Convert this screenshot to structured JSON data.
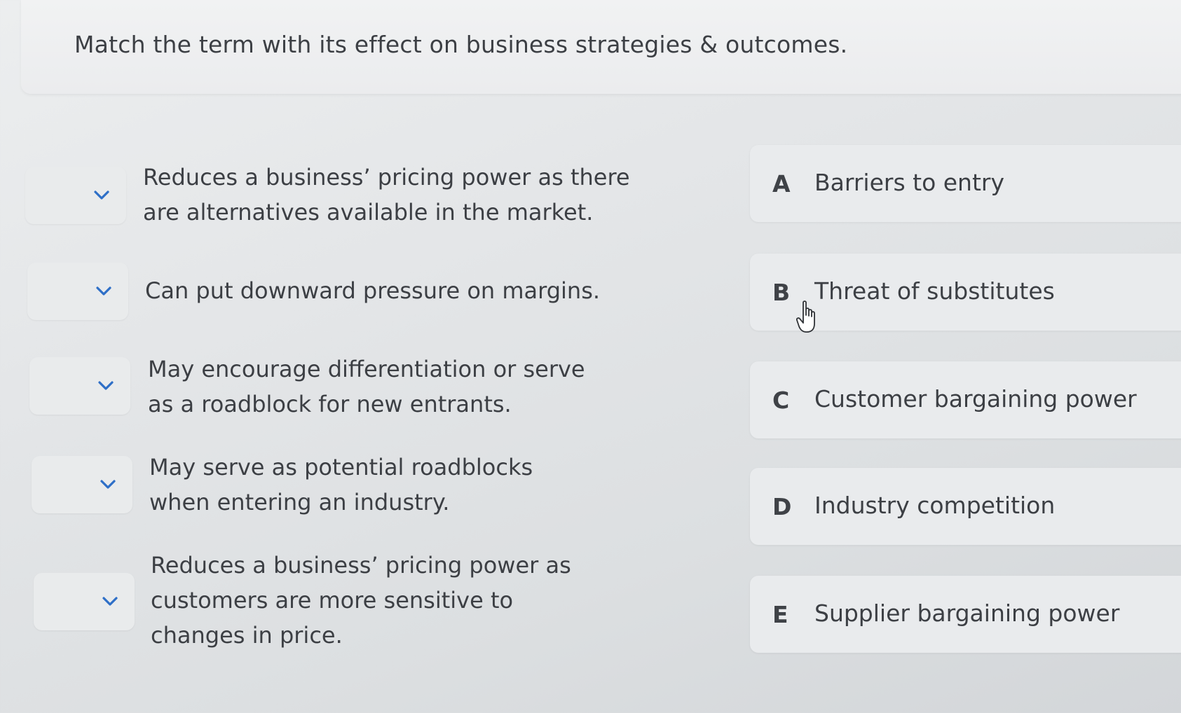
{
  "question": {
    "text": "Match the term with its effect on business strategies & outcomes."
  },
  "prompts": [
    {
      "text": "Reduces a business’ pricing power as there are alternatives available in the market.",
      "selected": ""
    },
    {
      "text": "Can put downward pressure on margins.",
      "selected": ""
    },
    {
      "text": "May encourage differentiation or serve as a roadblock for new entrants.",
      "selected": ""
    },
    {
      "text": "May serve as potential roadblocks when entering an industry.",
      "selected": ""
    },
    {
      "text": "Reduces a business’ pricing power as customers are more sensitive to changes in price.",
      "selected": ""
    }
  ],
  "options": [
    {
      "letter": "A",
      "label": "Barriers to entry"
    },
    {
      "letter": "B",
      "label": "Threat of substitutes"
    },
    {
      "letter": "C",
      "label": "Customer bargaining power"
    },
    {
      "letter": "D",
      "label": "Industry competition"
    },
    {
      "letter": "E",
      "label": "Supplier bargaining power"
    }
  ],
  "icons": {
    "dropdown": "chevron-down-icon",
    "cursor": "hand-pointer-icon"
  },
  "colors": {
    "chevron": "#2e6fc7",
    "card": "#e9ebed"
  }
}
